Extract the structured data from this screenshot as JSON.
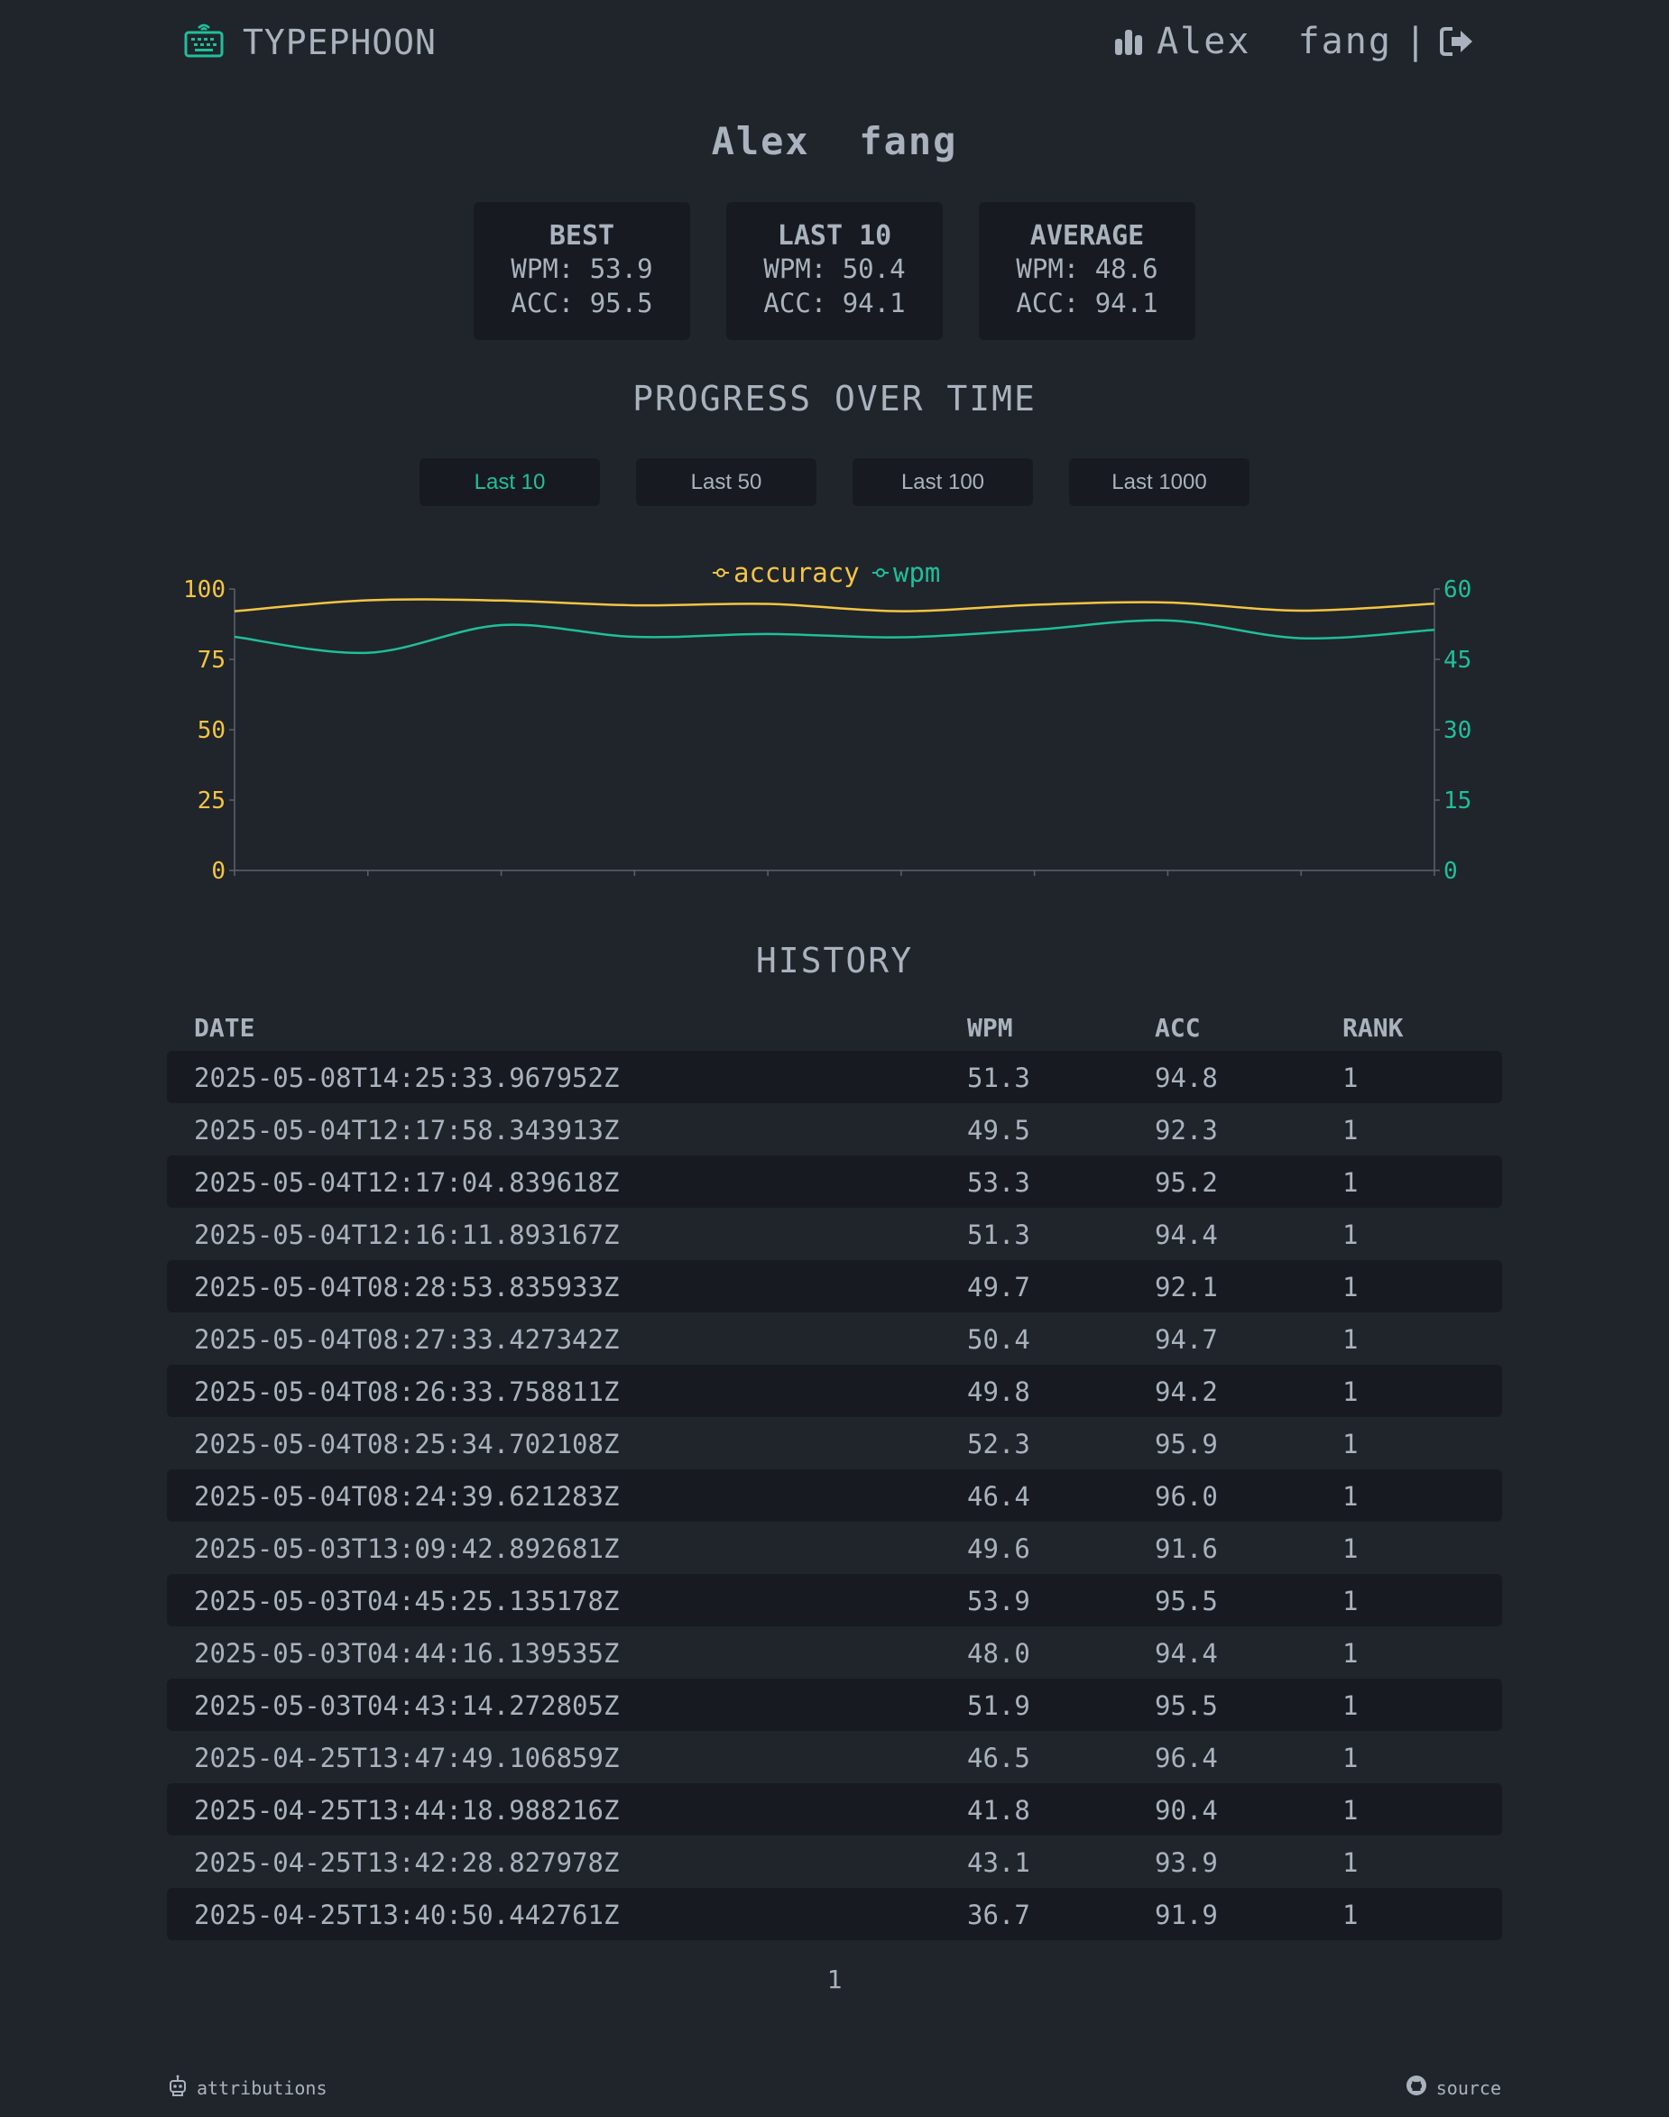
{
  "app": {
    "name": "TYPEPHOON"
  },
  "header": {
    "username": "Alex  fang",
    "separator": "|"
  },
  "profile": {
    "name": "Alex  fang"
  },
  "stats": [
    {
      "title": "BEST",
      "wpm": "WPM: 53.9",
      "acc": "ACC: 95.5"
    },
    {
      "title": "LAST 10",
      "wpm": "WPM: 50.4",
      "acc": "ACC: 94.1"
    },
    {
      "title": "AVERAGE",
      "wpm": "WPM: 48.6",
      "acc": "ACC: 94.1"
    }
  ],
  "progress": {
    "title": "PROGRESS OVER TIME",
    "ranges": [
      "Last 10",
      "Last 50",
      "Last 100",
      "Last 1000"
    ],
    "active_range": "Last 10"
  },
  "chart_data": {
    "type": "line",
    "title": "",
    "xlabel": "",
    "x": [
      1,
      2,
      3,
      4,
      5,
      6,
      7,
      8,
      9,
      10
    ],
    "series": [
      {
        "name": "wpm",
        "axis": "right",
        "color": "#1fbf9a",
        "values": [
          49.8,
          46.4,
          52.3,
          49.8,
          50.4,
          49.7,
          51.3,
          53.3,
          49.5,
          51.3
        ]
      },
      {
        "name": "accuracy",
        "axis": "left",
        "color": "#f5c542",
        "values": [
          92.1,
          96.0,
          95.9,
          94.2,
          94.7,
          92.1,
          94.4,
          95.2,
          92.3,
          94.8
        ]
      }
    ],
    "y_left": {
      "ticks": [
        0,
        25,
        50,
        75,
        100
      ],
      "ylim": [
        0,
        100
      ],
      "color": "#f5c542"
    },
    "y_right": {
      "ticks": [
        0,
        15,
        30,
        45,
        60
      ],
      "ylim": [
        0,
        60
      ],
      "color": "#1fbf9a"
    },
    "grid": false,
    "legend": "top-center"
  },
  "history": {
    "title": "HISTORY",
    "columns": {
      "date": "DATE",
      "wpm": "WPM",
      "acc": "ACC",
      "rank": "RANK"
    },
    "rows": [
      {
        "date": "2025-05-08T14:25:33.967952Z",
        "wpm": "51.3",
        "acc": "94.8",
        "rank": "1"
      },
      {
        "date": "2025-05-04T12:17:58.343913Z",
        "wpm": "49.5",
        "acc": "92.3",
        "rank": "1"
      },
      {
        "date": "2025-05-04T12:17:04.839618Z",
        "wpm": "53.3",
        "acc": "95.2",
        "rank": "1"
      },
      {
        "date": "2025-05-04T12:16:11.893167Z",
        "wpm": "51.3",
        "acc": "94.4",
        "rank": "1"
      },
      {
        "date": "2025-05-04T08:28:53.835933Z",
        "wpm": "49.7",
        "acc": "92.1",
        "rank": "1"
      },
      {
        "date": "2025-05-04T08:27:33.427342Z",
        "wpm": "50.4",
        "acc": "94.7",
        "rank": "1"
      },
      {
        "date": "2025-05-04T08:26:33.758811Z",
        "wpm": "49.8",
        "acc": "94.2",
        "rank": "1"
      },
      {
        "date": "2025-05-04T08:25:34.702108Z",
        "wpm": "52.3",
        "acc": "95.9",
        "rank": "1"
      },
      {
        "date": "2025-05-04T08:24:39.621283Z",
        "wpm": "46.4",
        "acc": "96.0",
        "rank": "1"
      },
      {
        "date": "2025-05-03T13:09:42.892681Z",
        "wpm": "49.6",
        "acc": "91.6",
        "rank": "1"
      },
      {
        "date": "2025-05-03T04:45:25.135178Z",
        "wpm": "53.9",
        "acc": "95.5",
        "rank": "1"
      },
      {
        "date": "2025-05-03T04:44:16.139535Z",
        "wpm": "48.0",
        "acc": "94.4",
        "rank": "1"
      },
      {
        "date": "2025-05-03T04:43:14.272805Z",
        "wpm": "51.9",
        "acc": "95.5",
        "rank": "1"
      },
      {
        "date": "2025-04-25T13:47:49.106859Z",
        "wpm": "46.5",
        "acc": "96.4",
        "rank": "1"
      },
      {
        "date": "2025-04-25T13:44:18.988216Z",
        "wpm": "41.8",
        "acc": "90.4",
        "rank": "1"
      },
      {
        "date": "2025-04-25T13:42:28.827978Z",
        "wpm": "43.1",
        "acc": "93.9",
        "rank": "1"
      },
      {
        "date": "2025-04-25T13:40:50.442761Z",
        "wpm": "36.7",
        "acc": "91.9",
        "rank": "1"
      }
    ]
  },
  "pagination": {
    "current": "1"
  },
  "footer": {
    "attributions": "attributions",
    "source": "source"
  },
  "icons": {
    "logo": "keyboard-icon",
    "stats": "bar-chart-icon",
    "logout": "logout-icon",
    "attributions": "robot-icon",
    "source": "github-icon"
  },
  "colors": {
    "background": "#20252c",
    "card": "#171b21",
    "text": "#aab2bd",
    "accent": "#1fbf9a",
    "accuracy": "#f5c542"
  }
}
